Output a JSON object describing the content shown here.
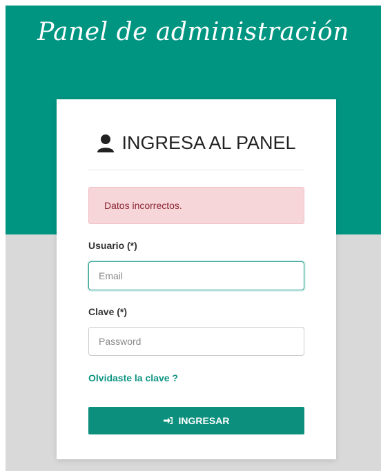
{
  "header": {
    "title": "Panel de administración"
  },
  "login": {
    "title": "INGRESA AL PANEL",
    "title_icon": "user-icon",
    "alert_text": "Datos incorrectos.",
    "user_label": "Usuario (*)",
    "email_placeholder": "Email",
    "email_value": "",
    "password_label": "Clave (*)",
    "password_placeholder": "Password",
    "password_value": "",
    "forgot_link": "Olvidaste la clave ?",
    "submit_label": "INGRESAR",
    "submit_icon": "sign-in-icon"
  },
  "colors": {
    "brand": "#009581",
    "button": "#0c8f7d",
    "alert_bg": "#f6d6d9",
    "alert_text": "#8a2430",
    "link": "#0e9583",
    "background": "#d9d9d9"
  }
}
